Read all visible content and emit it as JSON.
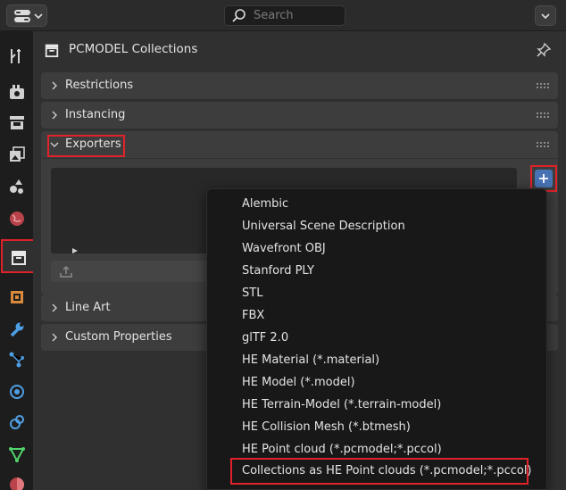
{
  "header": {
    "search_placeholder": "Search",
    "editor_type_icon": "editor-type-icon",
    "menu_icon": "chevron-down-icon"
  },
  "tabs": [
    {
      "name": "tab-tool",
      "icon": "tool-icon"
    },
    {
      "name": "tab-render",
      "icon": "render-icon"
    },
    {
      "name": "tab-output",
      "icon": "output-icon"
    },
    {
      "name": "tab-view-layer",
      "icon": "view-layer-icon"
    },
    {
      "name": "tab-scene",
      "icon": "scene-icon"
    },
    {
      "name": "tab-world",
      "icon": "world-icon"
    },
    {
      "name": "tab-collection",
      "icon": "collection-icon",
      "active": true
    },
    {
      "name": "tab-object",
      "icon": "object-icon"
    },
    {
      "name": "tab-modifiers",
      "icon": "wrench-icon"
    },
    {
      "name": "tab-particles",
      "icon": "particles-icon"
    },
    {
      "name": "tab-physics",
      "icon": "physics-icon"
    },
    {
      "name": "tab-constraints",
      "icon": "constraints-icon"
    },
    {
      "name": "tab-data",
      "icon": "data-icon"
    },
    {
      "name": "tab-material",
      "icon": "material-icon"
    }
  ],
  "properties": {
    "title": "PCMODEL Collections",
    "panels": {
      "restrictions": "Restrictions",
      "instancing": "Instancing",
      "exporters": "Exporters",
      "line_art": "Line Art",
      "custom_properties": "Custom Properties"
    }
  },
  "export_menu": {
    "items": [
      "Alembic",
      "Universal Scene Description",
      "Wavefront OBJ",
      "Stanford PLY",
      "STL",
      "FBX",
      "glTF 2.0",
      "HE Material (*.material)",
      "HE Model (*.model)",
      "HE Terrain-Model (*.terrain-model)",
      "HE Collision Mesh (*.btmesh)",
      "HE Point cloud (*.pcmodel;*.pccol)",
      "Collections as HE Point clouds (*.pcmodel;*.pccol)"
    ],
    "highlighted_index": 12
  },
  "colors": {
    "annotation_red": "#e0222a",
    "accent_blue": "#4772b3"
  }
}
